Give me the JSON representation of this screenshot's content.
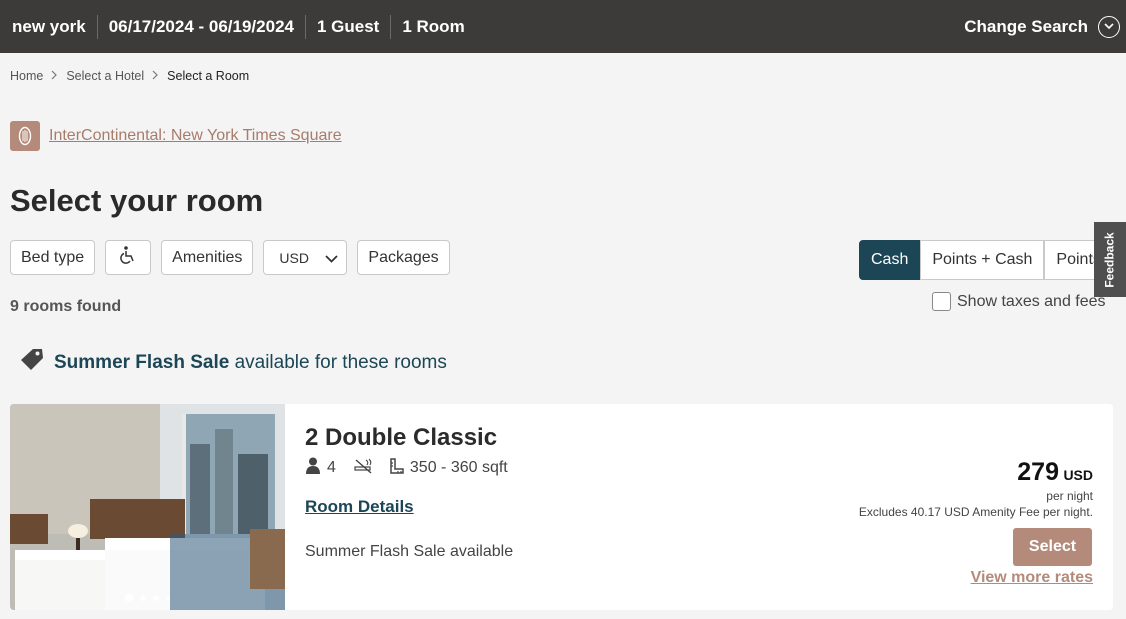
{
  "search_bar": {
    "location": "new york",
    "dates": "06/17/2024 - 06/19/2024",
    "guests": "1 Guest",
    "rooms": "1 Room",
    "change_label": "Change Search"
  },
  "breadcrumb": {
    "home": "Home",
    "select_hotel": "Select a Hotel",
    "current": "Select a Room"
  },
  "hotel": {
    "name": "InterContinental: New York Times Square"
  },
  "page_title": "Select your room",
  "filters": {
    "bed_type": "Bed type",
    "accessibility_icon": "wheelchair-icon",
    "amenities": "Amenities",
    "currency": "USD",
    "packages": "Packages"
  },
  "payment": {
    "options": [
      "Cash",
      "Points + Cash",
      "Points"
    ],
    "selected": "Cash"
  },
  "feedback_label": "Feedback",
  "taxes_label": "Show taxes and fees",
  "rooms_found": "9 rooms found",
  "promo": {
    "name": "Summer Flash Sale",
    "suffix": "available for these rooms"
  },
  "rooms": [
    {
      "name": "2 Double Classic",
      "guests": "4",
      "size": "350 - 360 sqft",
      "details_label": "Room Details",
      "sale_text": "Summer Flash Sale available",
      "price": "279",
      "currency": "USD",
      "per_night": "per night",
      "fee_note": "Excludes 40.17 USD Amenity Fee per night.",
      "select_label": "Select",
      "more_rates_label": "View more rates",
      "photo_count": 4,
      "photo_index": 1
    }
  ],
  "colors": {
    "topbar": "#3c3b39",
    "accent_copper": "#b48b7a",
    "brand_navy": "#1c4656"
  }
}
